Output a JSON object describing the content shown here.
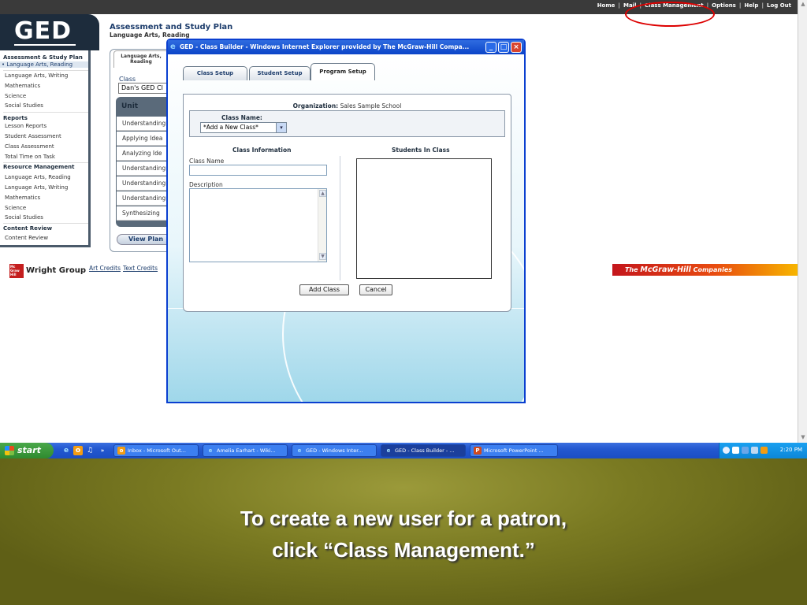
{
  "top_nav": {
    "home": "Home",
    "mail": "Mail",
    "class_management": "Class Management",
    "options": "Options",
    "help": "Help",
    "logout": "Log Out"
  },
  "brand": {
    "logo": "GED"
  },
  "left_nav": {
    "assessment_head": "Assessment & Study Plan",
    "assessment_items": [
      "Language Arts, Reading",
      "Language Arts, Writing",
      "Mathematics",
      "Science",
      "Social Studies"
    ],
    "reports_head": "Reports",
    "reports_items": [
      "Lesson Reports",
      "Student Assessment",
      "Class Assessment",
      "Total Time on Task"
    ],
    "resource_head": "Resource Management",
    "resource_items": [
      "Language Arts, Reading",
      "Language Arts, Writing",
      "Mathematics",
      "Science",
      "Social Studies"
    ],
    "content_head": "Content Review",
    "content_items": [
      "Content Review"
    ]
  },
  "main": {
    "title": "Assessment and Study Plan",
    "subtitle": "Language Arts, Reading",
    "tab": "Language Arts, Reading",
    "class_label": "Class",
    "class_value": "Dan's GED Cl",
    "unit_header": "Unit",
    "units": [
      "Understanding",
      "Applying Idea",
      "Analyzing Ide",
      "Understanding",
      "Understanding",
      "Understanding",
      "Synthesizing"
    ],
    "view_plan": "View Plan"
  },
  "footer": {
    "logo_text": "Mc Graw Hill",
    "wright_group": "Wright Group",
    "links": [
      "Art Credits",
      "Text Credits"
    ],
    "mh_the": "The",
    "mh_name": "McGraw-Hill",
    "mh_suffix": "Companies"
  },
  "modal": {
    "title": "GED - Class Builder - Windows Internet Explorer provided by The McGraw-Hill Compa...",
    "tabs": {
      "class_setup": "Class Setup",
      "student_setup": "Student Setup",
      "program_setup": "Program Setup"
    },
    "org_label": "Organization:",
    "org_value": "Sales Sample School",
    "classname_label": "Class Name:",
    "classname_selected": "*Add a New Class*",
    "class_info_heading": "Class Information",
    "students_heading": "Students In Class",
    "field_classname_label": "Class Name",
    "field_classname_value": "",
    "field_desc_label": "Description",
    "field_desc_value": "",
    "add_button": "Add Class",
    "cancel_button": "Cancel"
  },
  "taskbar": {
    "start": "start",
    "tasks": [
      "Inbox - Microsoft Out...",
      "Amelia Earhart - Wiki...",
      "GED - Windows Inter...",
      "GED - Class Builder - ...",
      "Microsoft PowerPoint ..."
    ],
    "clock": "2:20 PM"
  },
  "caption": {
    "line1": "To create a new user for a patron,",
    "line2": "click “Class Management.”"
  },
  "colors": {
    "annotation": "#dd0000",
    "nav_dark": "#1d2c3c",
    "accent_blue": "#1d3d6c",
    "xp_blue": "#0a3fd0",
    "caption_bg": "#7a7a22"
  }
}
